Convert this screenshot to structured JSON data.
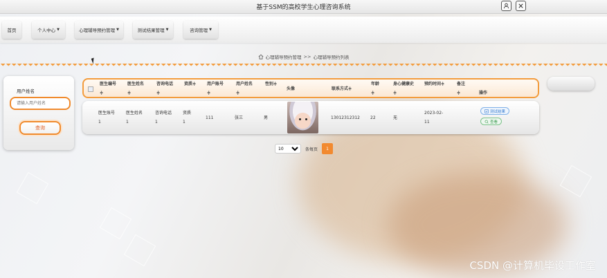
{
  "window": {
    "title": "基于SSM的高校学生心理咨询系统"
  },
  "nav": [
    "首页",
    "个人中心",
    "心理辅导预约管理",
    "测试结果管理",
    "咨询管理"
  ],
  "breadcrumb": {
    "part1": "心理辅导预约管理",
    "sep": ">>",
    "part2": "心理辅导预约列表"
  },
  "search": {
    "label": "用户姓名",
    "placeholder": "请输入用户姓名",
    "button": "查询"
  },
  "table": {
    "headers": [
      "医生编号",
      "医生姓名",
      "咨询电话",
      "资质",
      "用户账号",
      "用户姓名",
      "性别",
      "头像",
      "联系方式",
      "年龄",
      "身心健康史",
      "预约时间",
      "备注",
      "操作"
    ],
    "row": {
      "doctor_no": "医生账号1",
      "doctor_name": "医生姓名1",
      "phone": "咨询电话1",
      "qualification": "资质1",
      "user_account": "111",
      "user_name": "张三",
      "gender": "男",
      "contact": "13012312312",
      "age": "22",
      "history": "无",
      "appointment_time": "2023-02-11",
      "remark": "",
      "btn_test": "测试结果",
      "btn_view": "查看"
    }
  },
  "pager": {
    "page_size": "10",
    "per_page_label": "条每页",
    "current": "1"
  },
  "watermark": "CSDN @计算机毕设工作室",
  "accent_color": "#f39c3d"
}
